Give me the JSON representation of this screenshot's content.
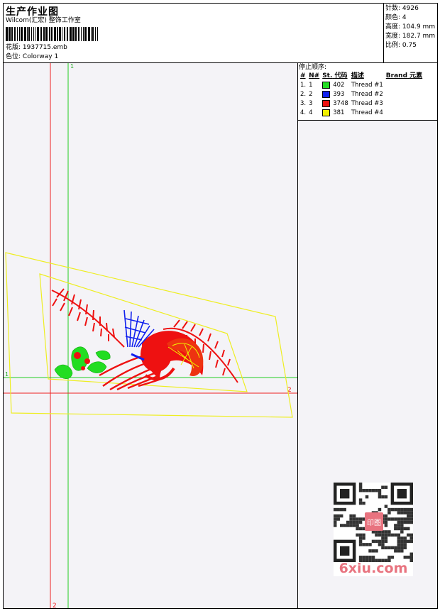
{
  "header": {
    "title": "生产作业图",
    "company": "Wilcom(汇宏) 整饰工作室",
    "design_label": "花版:",
    "design_file": "1937715.emb",
    "colorway_label": "色位:",
    "colorway": "Colorway 1"
  },
  "stats": [
    {
      "label": "针数:",
      "value": "4926"
    },
    {
      "label": "颜色:",
      "value": "4"
    },
    {
      "label": "高度:",
      "value": "104.9 mm"
    },
    {
      "label": "宽度:",
      "value": "182.7 mm"
    },
    {
      "label": "比例:",
      "value": "0.75"
    }
  ],
  "stop_sequence": {
    "title": "停止顺序:",
    "columns": [
      "#",
      "N#",
      "St.",
      "代码",
      "描述",
      "Brand",
      "元素"
    ],
    "rows": [
      {
        "num": "1.",
        "n": "1",
        "color": "#22dd22",
        "stitches": "402",
        "desc": "Thread #1"
      },
      {
        "num": "2.",
        "n": "2",
        "color": "#1020ee",
        "stitches": "393",
        "desc": "Thread #2"
      },
      {
        "num": "3.",
        "n": "3",
        "color": "#ee1111",
        "stitches": "3748",
        "desc": "Thread #3"
      },
      {
        "num": "4.",
        "n": "4",
        "color": "#f0f000",
        "stitches": "381",
        "desc": "Thread #4"
      }
    ]
  },
  "canvas": {
    "axis_green_label": "1",
    "axis_red_label": "2",
    "guide_green_color": "#22cc22",
    "guide_red_color": "#ee2222",
    "outline_color": "#eeee22"
  },
  "watermark": {
    "text": "6xiu.com",
    "seal": "印图"
  }
}
